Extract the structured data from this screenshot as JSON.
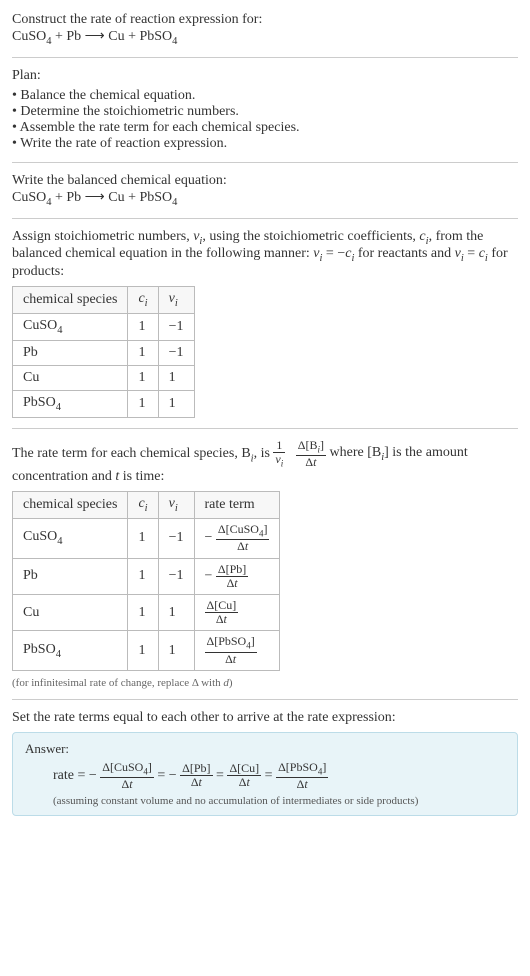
{
  "intro": {
    "prompt": "Construct the rate of reaction expression for:",
    "equation_html": "CuSO<sub>4</sub> + Pb  ⟶  Cu + PbSO<sub>4</sub>"
  },
  "plan": {
    "heading": "Plan:",
    "items": [
      "Balance the chemical equation.",
      "Determine the stoichiometric numbers.",
      "Assemble the rate term for each chemical species.",
      "Write the rate of reaction expression."
    ]
  },
  "balanced": {
    "heading": "Write the balanced chemical equation:",
    "equation_html": "CuSO<sub>4</sub> + Pb  ⟶  Cu + PbSO<sub>4</sub>"
  },
  "stoich": {
    "intro_html": "Assign stoichiometric numbers, <span class=\"ital\">ν<sub>i</sub></span>, using the stoichiometric coefficients, <span class=\"ital\">c<sub>i</sub></span>, from the balanced chemical equation in the following manner: <span class=\"ital\">ν<sub>i</sub></span> = −<span class=\"ital\">c<sub>i</sub></span> for reactants and <span class=\"ital\">ν<sub>i</sub></span> = <span class=\"ital\">c<sub>i</sub></span> for products:",
    "headers": {
      "species": "chemical species",
      "ci_html": "<span class=\"ital\">c<sub>i</sub></span>",
      "vi_html": "<span class=\"ital\">ν<sub>i</sub></span>"
    },
    "rows": [
      {
        "species_html": "CuSO<sub>4</sub>",
        "ci": "1",
        "vi": "−1"
      },
      {
        "species_html": "Pb",
        "ci": "1",
        "vi": "−1"
      },
      {
        "species_html": "Cu",
        "ci": "1",
        "vi": "1"
      },
      {
        "species_html": "PbSO<sub>4</sub>",
        "ci": "1",
        "vi": "1"
      }
    ]
  },
  "rateterm": {
    "intro_pre": "The rate term for each chemical species, B",
    "intro_mid": ", is ",
    "frac1_num": "1",
    "frac1_den_html": "<span class=\"ital\">ν<sub>i</sub></span>",
    "frac2_num_html": "Δ[B<sub><span class=\"ital\">i</span></sub>]",
    "frac2_den_html": "Δ<span class=\"ital\">t</span>",
    "intro_post_html": " where [B<sub><span class=\"ital\">i</span></sub>] is the amount concentration and <span class=\"ital\">t</span> is time:",
    "headers": {
      "species": "chemical species",
      "ci_html": "<span class=\"ital\">c<sub>i</sub></span>",
      "vi_html": "<span class=\"ital\">ν<sub>i</sub></span>",
      "rate": "rate term"
    },
    "rows": [
      {
        "species_html": "CuSO<sub>4</sub>",
        "ci": "1",
        "vi": "−1",
        "rate_num_html": "Δ[CuSO<sub>4</sub>]",
        "rate_den_html": "Δ<span class=\"ital\">t</span>",
        "neg": true
      },
      {
        "species_html": "Pb",
        "ci": "1",
        "vi": "−1",
        "rate_num_html": "Δ[Pb]",
        "rate_den_html": "Δ<span class=\"ital\">t</span>",
        "neg": true
      },
      {
        "species_html": "Cu",
        "ci": "1",
        "vi": "1",
        "rate_num_html": "Δ[Cu]",
        "rate_den_html": "Δ<span class=\"ital\">t</span>",
        "neg": false
      },
      {
        "species_html": "PbSO<sub>4</sub>",
        "ci": "1",
        "vi": "1",
        "rate_num_html": "Δ[PbSO<sub>4</sub>]",
        "rate_den_html": "Δ<span class=\"ital\">t</span>",
        "neg": false
      }
    ],
    "note_html": "(for infinitesimal rate of change, replace Δ with <span class=\"ital\">d</span>)"
  },
  "final": {
    "heading": "Set the rate terms equal to each other to arrive at the rate expression:",
    "answer_label": "Answer:",
    "rate_label": "rate = ",
    "terms": [
      {
        "neg": true,
        "num_html": "Δ[CuSO<sub>4</sub>]",
        "den_html": "Δ<span class=\"ital\">t</span>"
      },
      {
        "neg": true,
        "num_html": "Δ[Pb]",
        "den_html": "Δ<span class=\"ital\">t</span>"
      },
      {
        "neg": false,
        "num_html": "Δ[Cu]",
        "den_html": "Δ<span class=\"ital\">t</span>"
      },
      {
        "neg": false,
        "num_html": "Δ[PbSO<sub>4</sub>]",
        "den_html": "Δ<span class=\"ital\">t</span>"
      }
    ],
    "assume": "(assuming constant volume and no accumulation of intermediates or side products)"
  }
}
